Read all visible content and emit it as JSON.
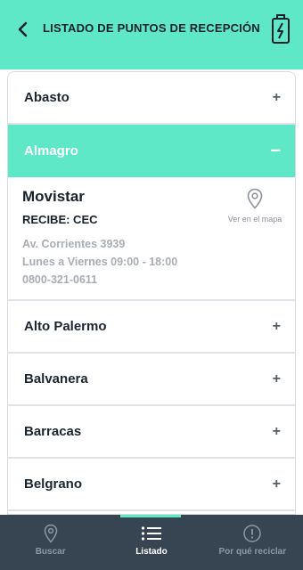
{
  "colors": {
    "accent": "#5ee8c8",
    "tabbar": "#374552",
    "text": "#17212b",
    "muted": "#a8adb3"
  },
  "header": {
    "title": "LISTADO DE PUNTOS DE RECEPCIÓN",
    "back_icon": "chevron-left-icon",
    "action_icon": "battery-charging-icon"
  },
  "list": {
    "items": [
      {
        "label": "Abasto",
        "toggle": "+"
      },
      {
        "label": "Almagro",
        "toggle": "−"
      },
      {
        "label": "Alto Palermo",
        "toggle": "+"
      },
      {
        "label": "Balvanera",
        "toggle": "+"
      },
      {
        "label": "Barracas",
        "toggle": "+"
      },
      {
        "label": "Belgrano",
        "toggle": "+"
      }
    ],
    "expanded": {
      "name": "Movistar",
      "receives": "RECIBE: CEC",
      "address": "Av. Corrientes 3939",
      "hours": "Lunes a Viernes 09:00 - 18:00",
      "phone": "0800-321-0611",
      "map_link": "Ver en el mapa"
    }
  },
  "tabs": [
    {
      "label": "Buscar",
      "icon": "map-pin-icon"
    },
    {
      "label": "Listado",
      "icon": "list-icon"
    },
    {
      "label": "Por qué reciclar",
      "icon": "info-icon"
    }
  ]
}
